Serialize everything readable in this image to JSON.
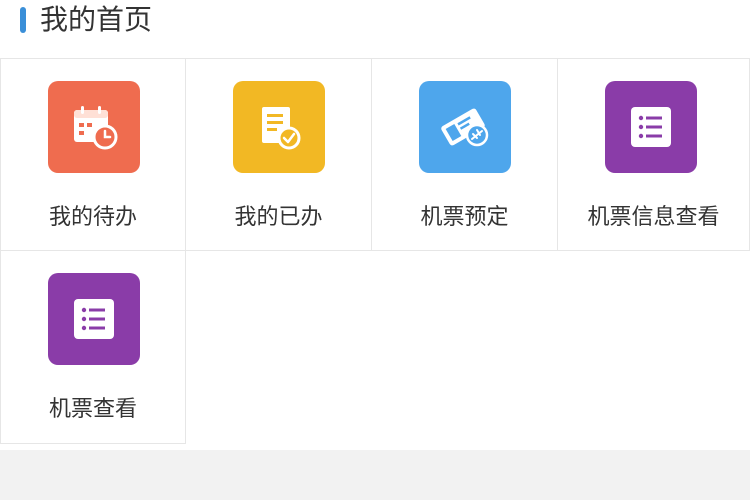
{
  "header": {
    "title": "我的首页",
    "accent_color": "#3a8fd8"
  },
  "tiles": [
    {
      "label": "我的待办",
      "icon": "calendar-clock-icon",
      "color": "#ef6c4f"
    },
    {
      "label": "我的已办",
      "icon": "document-check-icon",
      "color": "#f2b824"
    },
    {
      "label": "机票预定",
      "icon": "plane-ticket-icon",
      "color": "#4ea6ec"
    },
    {
      "label": "机票信息查看",
      "icon": "list-icon",
      "color": "#8a3ca8"
    },
    {
      "label": "机票查看",
      "icon": "list-icon",
      "color": "#8a3ca8"
    }
  ]
}
